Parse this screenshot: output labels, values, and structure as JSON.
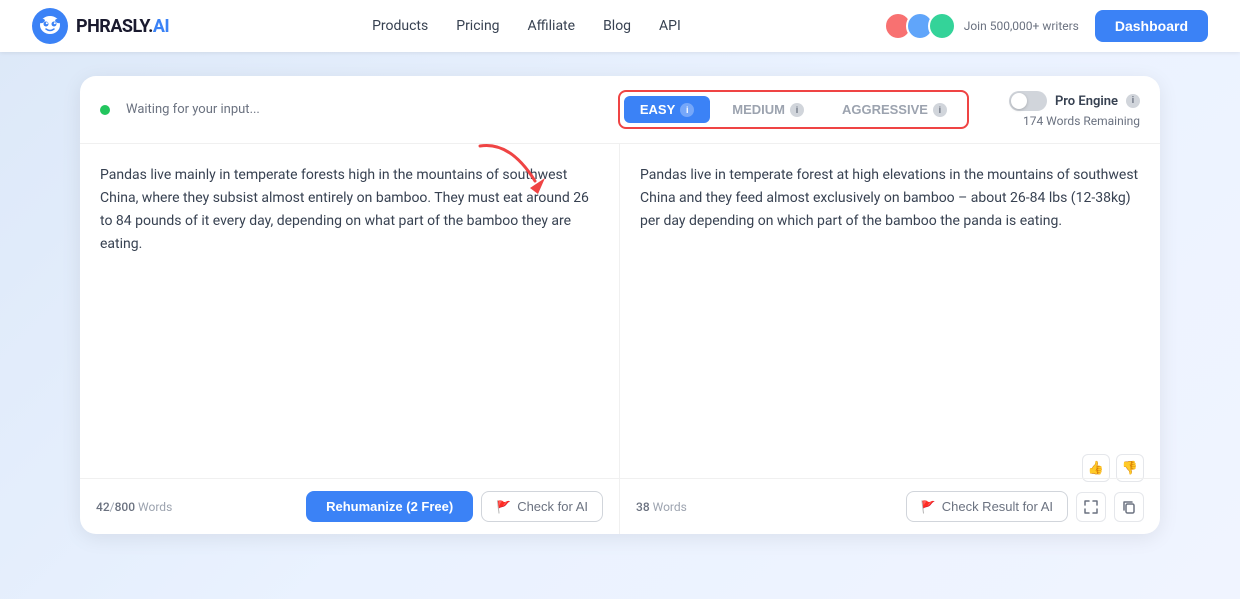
{
  "navbar": {
    "logo_text": "PHRASLY.AI",
    "logo_text_colored": "AI",
    "nav_links": [
      {
        "label": "Products",
        "has_dropdown": true
      },
      {
        "label": "Pricing"
      },
      {
        "label": "Affiliate"
      },
      {
        "label": "Blog"
      },
      {
        "label": "API"
      }
    ],
    "join_text": "Join 500,000+ writers",
    "dashboard_label": "Dashboard"
  },
  "toolbar": {
    "status_text": "Waiting for your input...",
    "modes": [
      {
        "label": "EASY",
        "active": true
      },
      {
        "label": "MEDIUM",
        "active": false
      },
      {
        "label": "AGGRESSIVE",
        "active": false
      }
    ],
    "pro_engine_label": "Pro Engine",
    "words_remaining": "174 Words Remaining"
  },
  "left_panel": {
    "text": "Pandas live mainly in temperate forests high in the mountains of southwest China, where they subsist almost entirely on bamboo. They must eat around 26 to 84 pounds of it every day, depending on what part of the bamboo they are eating.",
    "word_count": "42",
    "word_limit": "800",
    "rehumanize_label": "Rehumanize (2 Free)",
    "check_ai_label": "Check for AI"
  },
  "right_panel": {
    "text": "Pandas live in temperate forest at high elevations in the mountains of southwest China and they feed almost exclusively on bamboo – about 26-84 lbs (12-38kg) per day depending on which part of the bamboo the panda is eating.",
    "word_count": "38",
    "check_result_label": "Check Result for AI"
  }
}
